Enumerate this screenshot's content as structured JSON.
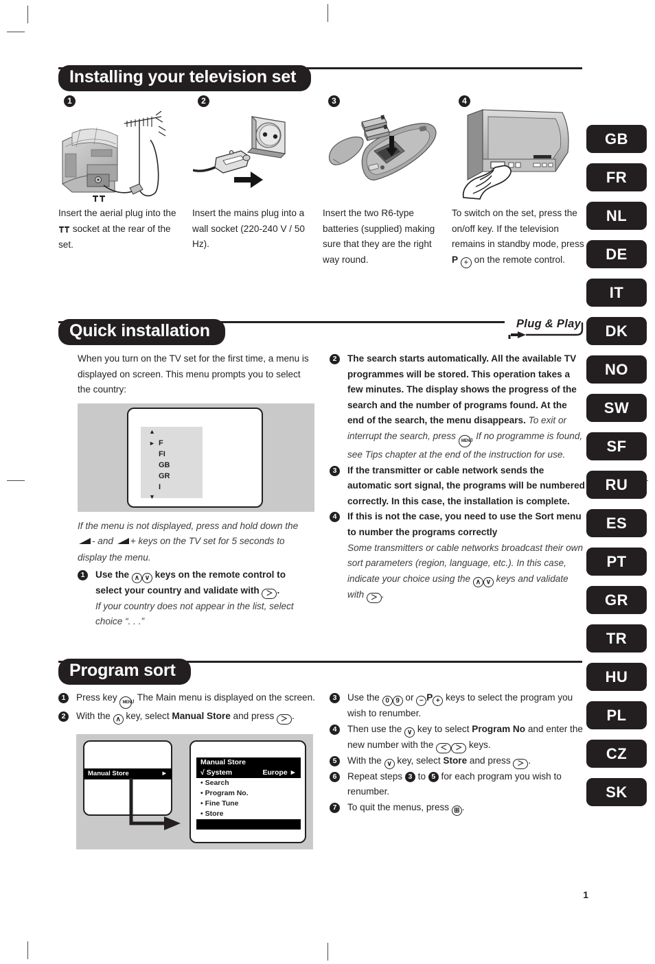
{
  "sections": {
    "install": {
      "title": "Installing your television set",
      "steps": [
        {
          "num": "1",
          "icon": "tv-aerial-illustration",
          "text_before": "Insert the aerial plug into the ",
          "text_after": " socket at the rear of the set."
        },
        {
          "num": "2",
          "icon": "mains-plug-socket-illustration",
          "text": "Insert the mains plug into a wall socket (220-240 V / 50 Hz)."
        },
        {
          "num": "3",
          "icon": "remote-batteries-illustration",
          "text": "Insert the two R6-type batteries (supplied) making sure that they are the right way round."
        },
        {
          "num": "4",
          "icon": "tv-power-button-illustration",
          "text_1": "To switch on the set, press the on/off key. If the television remains in standby mode, press ",
          "key_label": "P",
          "text_2": " on the remote control."
        }
      ]
    },
    "quick": {
      "title": "Quick installation",
      "plug_and_play": "Plug & Play",
      "intro": "When you turn on the TV set for the first time, a menu is displayed on screen. This menu prompts you to select the country:",
      "country_menu": {
        "up_arrow": "▲",
        "down_arrow": "▼",
        "cursor": "►",
        "items": [
          "F",
          "FI",
          "GB",
          "GR",
          "I"
        ]
      },
      "note_menu_not_displayed_1": "If the menu is not displayed, press and hold down the ",
      "note_menu_not_displayed_2": "- and ",
      "note_menu_not_displayed_3": "+ keys on the TV set for 5 seconds to display the menu.",
      "steps": [
        {
          "num": "1",
          "bold_1": "Use the ",
          "keys": [
            "∧",
            "∨"
          ],
          "bold_2": " keys on the remote control to select your country and validate with ",
          "ok_key": "＞",
          "bold_3": ".",
          "italic": "If your country does not appear in the list, select choice “. . .”"
        },
        {
          "num": "2",
          "bold": "The search starts automatically. All the available TV programmes will be stored. This operation takes a few minutes. The display shows the progress of the search and the number of programs found.  At the end of the search, the menu disappears.",
          "italic_1": " To exit or interrupt the search, press ",
          "menu_key": "MENU",
          "italic_2": ". If no programme is found, see Tips chapter at the end of the instruction for use."
        },
        {
          "num": "3",
          "bold": "If the transmitter or cable network sends the automatic sort signal, the programs will be numbered correctly. In this case, the installation is complete."
        },
        {
          "num": "4",
          "bold_1": "If this is not the case, you need to use the ",
          "bold_sort": "Sort",
          "bold_2": " menu to number the programs correctly",
          "italic_1": "Some transmitters or cable networks broadcast their own sort parameters (region, language, etc.). In this case, indicate your choice using the ",
          "keys": [
            "∧",
            "∨"
          ],
          "italic_2": " keys and validate with ",
          "ok_key": "＞",
          "italic_3": "."
        }
      ]
    },
    "program_sort": {
      "title": "Program sort",
      "steps_left": [
        {
          "num": "1",
          "t1": "Press key ",
          "key": "MENU",
          "t2": ". The Main menu is displayed on the screen."
        },
        {
          "num": "2",
          "t1": "With the ",
          "key": "∧",
          "t2": " key, select ",
          "bold": "Manual Store",
          "t3": " and press ",
          "key2": "＞",
          "t4": "."
        }
      ],
      "steps_right": [
        {
          "num": "3",
          "t1": "Use the ",
          "key_a": "0",
          "key_b": "9",
          "t2": " or ",
          "key_c": "−",
          "key_p": "P",
          "key_d": "+",
          "t3": " keys to select the program you wish to renumber."
        },
        {
          "num": "4",
          "t1": "Then use the ",
          "key_a": "∨",
          "t2": " key to select ",
          "bold": "Program No",
          "t3": " and enter the new number with the ",
          "key_b": "＜",
          "key_c": "＞",
          "t4": " keys."
        },
        {
          "num": "5",
          "t1": "With the ",
          "key_a": "∨",
          "t2": " key, select ",
          "bold": "Store",
          "t3": " and press ",
          "key_b": "＞",
          "t4": "."
        },
        {
          "num": "6",
          "t1": "Repeat steps ",
          "badge_a": "3",
          "t2": " to ",
          "badge_b": "5",
          "t3": " for each program you wish to renumber."
        },
        {
          "num": "7",
          "t1": "To quit the menus, press ",
          "key_a": "⊞",
          "t2": "."
        }
      ],
      "diagram": {
        "left_item": "Manual Store",
        "left_arrow": "►",
        "menu_title": "Manual Store",
        "selected_check": "√",
        "selected_label": "System",
        "selected_value": "Europe",
        "selected_arrow": "►",
        "items": [
          "Search",
          "Program No.",
          "Fine Tune",
          "Store"
        ],
        "bullet": "•"
      }
    }
  },
  "languages": [
    "GB",
    "FR",
    "NL",
    "DE",
    "IT",
    "DK",
    "NO",
    "SW",
    "SF",
    "RU",
    "ES",
    "PT",
    "GR",
    "TR",
    "HU",
    "PL",
    "CZ",
    "SK"
  ],
  "page_number": "1",
  "colors": {
    "ink": "#231f20",
    "panel": "#c9c9c9",
    "osd_grey": "#dcdcdc"
  }
}
